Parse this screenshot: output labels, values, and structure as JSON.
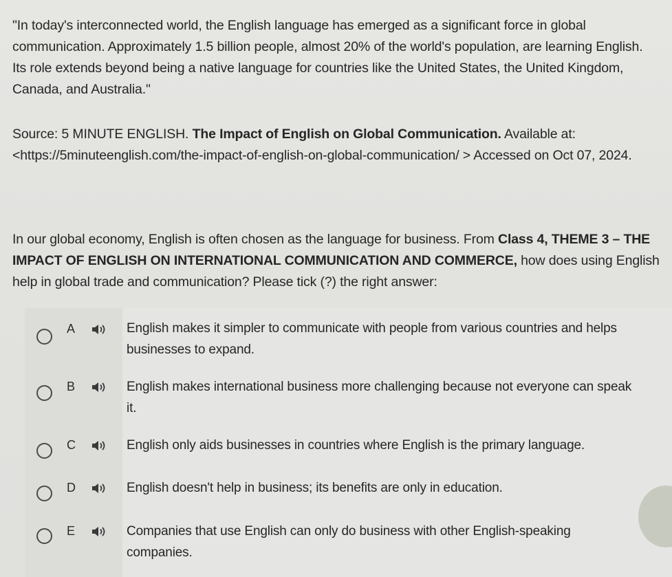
{
  "quote": {
    "lines": [
      "\"In today's interconnected world, the English language has emerged as a significant force in global",
      "communication. Approximately 1.5 billion people, almost 20% of the world's population, are learning English.",
      "Its role extends beyond being a native language for countries like the United States, the United Kingdom,",
      "Canada, and Australia.\""
    ]
  },
  "source": {
    "prefix": "Source: 5 MINUTE ENGLISH. ",
    "title": "The Impact of English on Global Communication.",
    "suffix": " Available at:",
    "url_line": "<https://5minuteenglish.com/the-impact-of-english-on-global-communication/ > Accessed on Oct 07, 2024."
  },
  "question": {
    "line1_prefix": "In our global economy, English is often chosen as the language for business. From ",
    "line1_bold": "Class 4, THEME 3 – THE",
    "line2_bold": "IMPACT OF ENGLISH ON INTERNATIONAL COMMUNICATION AND COMMERCE,",
    "line2_suffix": " how does using English",
    "line3": "help in global trade and communication? Please tick (?) the right answer:"
  },
  "options": [
    {
      "letter": "A",
      "lines": [
        "English makes it simpler to communicate with people from various countries and helps",
        "businesses to expand."
      ]
    },
    {
      "letter": "B",
      "lines": [
        "English makes international business more challenging because not everyone can speak",
        "it."
      ]
    },
    {
      "letter": "C",
      "lines": [
        "English only aids businesses in countries where English is the primary language."
      ]
    },
    {
      "letter": "D",
      "lines": [
        "English doesn't help in business; its benefits are only in education."
      ]
    },
    {
      "letter": "E",
      "lines": [
        "Companies that use English can only do business with other English-speaking",
        "companies."
      ]
    }
  ],
  "icons": {
    "radio": "radio-button-icon",
    "speaker": "speaker-icon"
  }
}
